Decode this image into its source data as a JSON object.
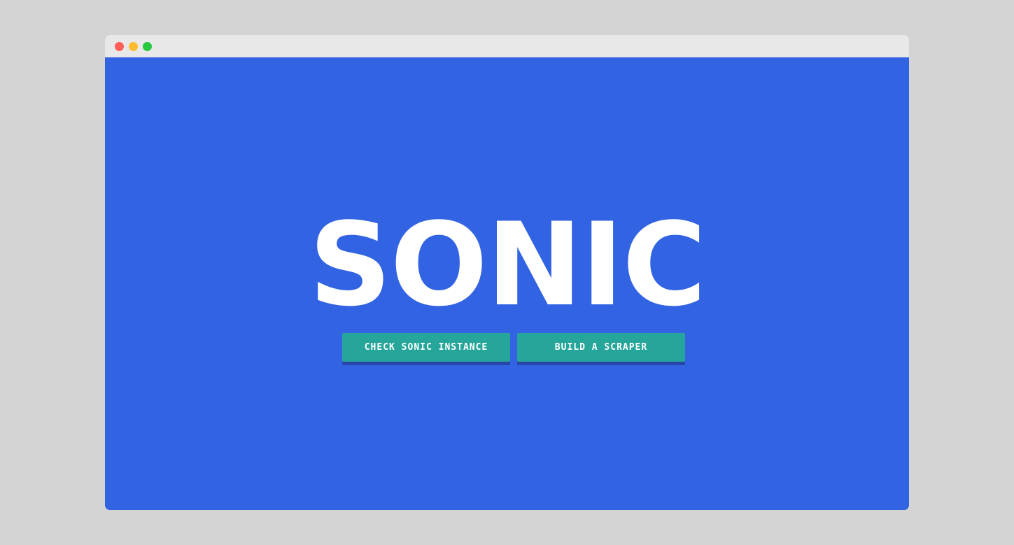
{
  "window": {
    "controls": [
      {
        "name": "close",
        "color": "#ff5f57"
      },
      {
        "name": "minimize",
        "color": "#febc2e"
      },
      {
        "name": "maximize",
        "color": "#28c840"
      }
    ]
  },
  "hero": {
    "title": "SONIC",
    "background_color": "#3163e2"
  },
  "buttons": {
    "check_label": "CHECK SONIC INSTANCE",
    "build_label": "BUILD A SCRAPER",
    "color": "#26a69a"
  }
}
